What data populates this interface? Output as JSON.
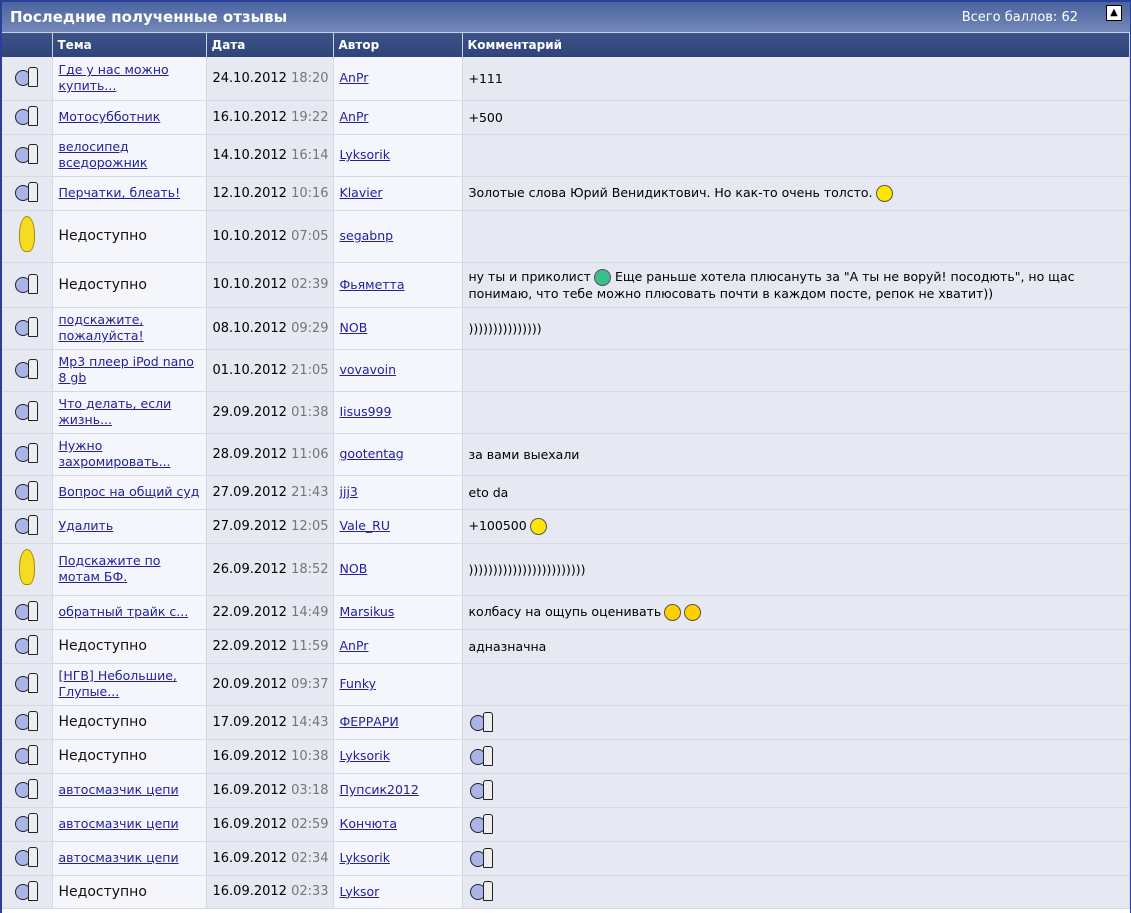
{
  "header": {
    "title": "Последние полученные отзывы",
    "total": "Всего баллов: 62"
  },
  "columns": [
    "",
    "Тема",
    "Дата",
    "Автор",
    "Комментарий"
  ],
  "rows": [
    {
      "icon": "thumb",
      "topic": "Где у нас можно купить...",
      "link": true,
      "date": "24.10.2012",
      "time": "18:20",
      "author": "AnPr",
      "comment": "+111",
      "emo": [],
      "h": 43
    },
    {
      "icon": "thumb",
      "topic": "Мотосубботник",
      "link": true,
      "date": "16.10.2012",
      "time": "19:22",
      "author": "AnPr",
      "comment": "+500",
      "emo": [],
      "h": 34
    },
    {
      "icon": "thumb",
      "topic": "велосипед вседорожник",
      "link": true,
      "date": "14.10.2012",
      "time": "16:14",
      "author": "Lyksorik",
      "comment": "",
      "emo": [],
      "h": 42
    },
    {
      "icon": "thumb",
      "topic": "Перчатки, блеать!",
      "link": true,
      "date": "12.10.2012",
      "time": "10:16",
      "author": "Klavier",
      "comment": "Золотые слова Юрий Венидиктович. Но как-то очень толсто.",
      "emo": [
        "smile"
      ],
      "h": 34
    },
    {
      "icon": "banana",
      "topic": "Недоступно",
      "link": false,
      "date": "10.10.2012",
      "time": "07:05",
      "author": "segabnp",
      "comment": "",
      "emo": [],
      "h": 52
    },
    {
      "icon": "thumb",
      "topic": "Недоступно",
      "link": false,
      "date": "10.10.2012",
      "time": "02:39",
      "author": "Фьяметта",
      "comment": "ну ты и приколист",
      "emo": [
        "green"
      ],
      "comment2": "Еще раньше хотела плюсануть за \"А ты не воруй! посодють\", но щас понимаю, что тебе можно плюсовать почти в каждом посте, репок не хватит))",
      "h": 45
    },
    {
      "icon": "thumb",
      "topic": "подскажите, пожалуйста!",
      "link": true,
      "date": "08.10.2012",
      "time": "09:29",
      "author": "NOB",
      "comment": ")))))))))))))))",
      "emo": [],
      "h": 42
    },
    {
      "icon": "thumb",
      "topic": "Mp3 плеер iPod nano 8 gb",
      "link": true,
      "date": "01.10.2012",
      "time": "21:05",
      "author": "vovavoin",
      "comment": "",
      "emo": [],
      "h": 42
    },
    {
      "icon": "thumb",
      "topic": "Что делать, если жизнь...",
      "link": true,
      "date": "29.09.2012",
      "time": "01:38",
      "author": "Iisus999",
      "comment": "",
      "emo": [],
      "h": 42
    },
    {
      "icon": "thumb",
      "topic": "Нужно захромировать...",
      "link": true,
      "date": "28.09.2012",
      "time": "11:06",
      "author": "gootentag",
      "comment": "за вами выехали",
      "emo": [],
      "h": 42
    },
    {
      "icon": "thumb",
      "topic": "Вопрос на общий суд",
      "link": true,
      "date": "27.09.2012",
      "time": "21:43",
      "author": "jjj3",
      "comment": "eto da",
      "emo": [],
      "h": 34
    },
    {
      "icon": "thumb",
      "topic": "Удалить",
      "link": true,
      "date": "27.09.2012",
      "time": "12:05",
      "author": "Vale_RU",
      "comment": "+100500",
      "emo": [
        "smile"
      ],
      "h": 34
    },
    {
      "icon": "banana",
      "topic": "Подскажите по мотам БФ.",
      "link": true,
      "date": "26.09.2012",
      "time": "18:52",
      "author": "NOB",
      "comment": "))))))))))))))))))))))))",
      "emo": [],
      "h": 52
    },
    {
      "icon": "thumb",
      "topic": "обратный трайк с...",
      "link": true,
      "date": "22.09.2012",
      "time": "14:49",
      "author": "Marsikus",
      "comment": "колбасу на ощупь оценивать",
      "emo": [
        "grin",
        "grin"
      ],
      "h": 34
    },
    {
      "icon": "thumb",
      "topic": "Недоступно",
      "link": false,
      "date": "22.09.2012",
      "time": "11:59",
      "author": "AnPr",
      "comment": "адназначна",
      "emo": [],
      "h": 34
    },
    {
      "icon": "thumb",
      "topic": "[НГВ] Небольшие, Глупые...",
      "link": true,
      "date": "20.09.2012",
      "time": "09:37",
      "author": "Funky",
      "comment": "",
      "emo": [],
      "h": 42
    },
    {
      "icon": "thumb",
      "topic": "Недоступно",
      "link": false,
      "date": "17.09.2012",
      "time": "14:43",
      "author": "ФЕРРАРИ",
      "comment": "",
      "emo": [
        "thumb"
      ],
      "h": 34
    },
    {
      "icon": "thumb",
      "topic": "Недоступно",
      "link": false,
      "date": "16.09.2012",
      "time": "10:38",
      "author": "Lyksorik",
      "comment": "",
      "emo": [
        "thumb"
      ],
      "h": 34
    },
    {
      "icon": "thumb",
      "topic": "автосмазчик цепи",
      "link": true,
      "date": "16.09.2012",
      "time": "03:18",
      "author": "Пупсик2012",
      "comment": "",
      "emo": [
        "thumb"
      ],
      "h": 34
    },
    {
      "icon": "thumb",
      "topic": "автосмазчик цепи",
      "link": true,
      "date": "16.09.2012",
      "time": "02:59",
      "author": "Кончюта",
      "comment": "",
      "emo": [
        "thumb"
      ],
      "h": 34
    },
    {
      "icon": "thumb",
      "topic": "автосмазчик цепи",
      "link": true,
      "date": "16.09.2012",
      "time": "02:34",
      "author": "Lyksorik",
      "comment": "",
      "emo": [
        "thumb"
      ],
      "h": 34
    },
    {
      "icon": "thumb",
      "topic": "Недоступно",
      "link": false,
      "date": "16.09.2012",
      "time": "02:33",
      "author": "Lyksor",
      "comment": "",
      "emo": [
        "thumb"
      ],
      "h": 33
    }
  ]
}
